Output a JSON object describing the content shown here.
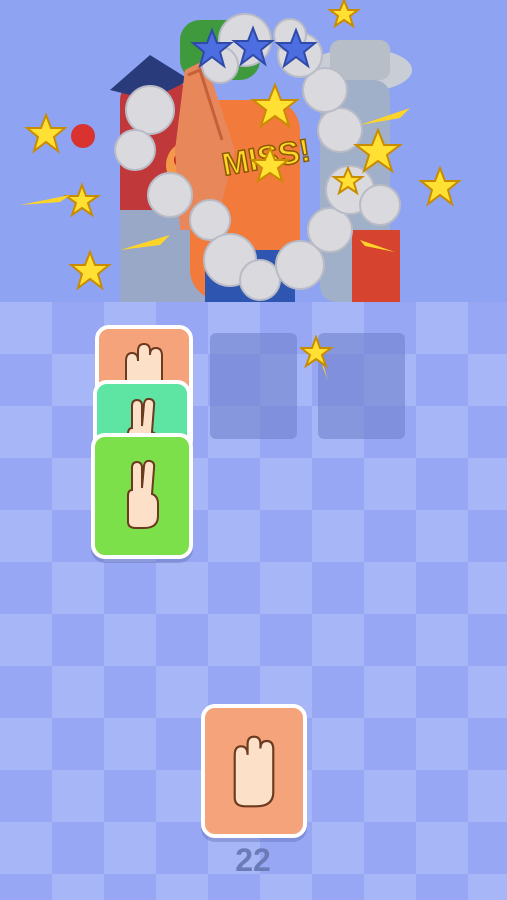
{
  "game": {
    "title_text": "",
    "hit_text": "MISS!",
    "stars_earned": 3,
    "stars_total": 3,
    "counter": "22"
  },
  "played_cards": [
    {
      "gesture": "four-fingers-hand-icon",
      "color": "#f5a37a"
    },
    {
      "gesture": "two-fingers-hand-icon",
      "color": "#5ee4a3"
    },
    {
      "gesture": "two-fingers-hand-icon",
      "color": "#7ce04a"
    }
  ],
  "hand_card": {
    "gesture": "four-fingers-hand-icon",
    "color": "#f5a37a"
  },
  "colors": {
    "sky": "#8ea3f2",
    "star": "#ffe033",
    "cloud": "#d9d9de",
    "board": "#a7b6f7"
  }
}
